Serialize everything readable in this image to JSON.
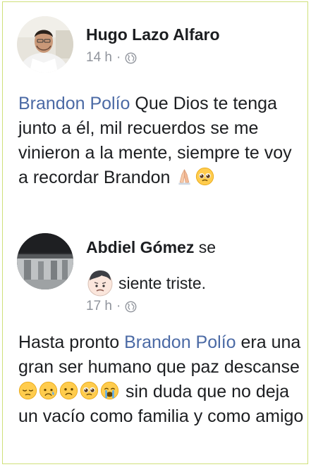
{
  "comments": [
    {
      "author": "Hugo Lazo Alfaro",
      "time": "14 h",
      "separator": "·",
      "mention": "Brandon Polío",
      "text": " Que Dios te tenga junto a él, mil recuerdos se me vinieron a la mente, siempre te voy a recordar Brandon ",
      "emojis": [
        "folded-hands-icon",
        "pleading-face-icon"
      ]
    },
    {
      "author": "Abdiel Gómez",
      "feeling_prefix": " se",
      "feeling_text": "siente triste.",
      "feeling_emoji": "sad-face-icon",
      "time": "17 h",
      "separator": "·",
      "text_before": "Hasta pronto ",
      "mention": "Brandon Polío",
      "text_after": " era una gran ser humano que paz descanse ",
      "emojis": [
        "pensive-face-icon",
        "disappointed-relieved-face-icon",
        "frowning-face-icon",
        "pleading-face-icon",
        "crying-face-icon"
      ],
      "text_end": " sin duda que no deja un vacío como familia y como amigo"
    }
  ],
  "colors": {
    "mention": "#4b6aa5",
    "meta": "#90949c",
    "border": "#cfe07a"
  }
}
